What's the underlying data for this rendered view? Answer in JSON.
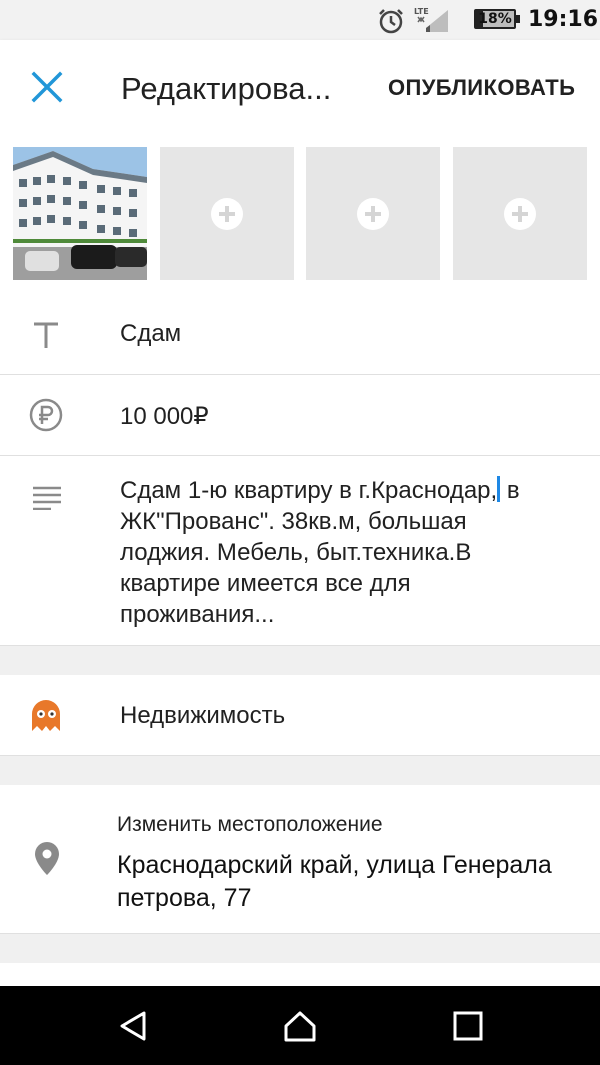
{
  "status_bar": {
    "network": "LTE",
    "battery": "18%",
    "time": "19:16"
  },
  "app_bar": {
    "title": "Редактирова...",
    "publish_label": "ОПУБЛИКОВАТЬ",
    "accent_color": "#2196d8"
  },
  "photos": {
    "slots": [
      {
        "state": "filled"
      },
      {
        "state": "empty"
      },
      {
        "state": "empty"
      },
      {
        "state": "empty"
      }
    ]
  },
  "form": {
    "title": "Сдам",
    "price": "10 000₽",
    "description_before_cursor": "Сдам 1-ю квартиру в г.Краснодар,",
    "description_after_cursor": " в\nЖК\"Прованс\". 38кв.м, большая\nлоджия. Мебель, быт.техника.В\nквартире имеется все для\nпроживания...",
    "category": "Недвижимость",
    "category_icon_color": "#e8782a",
    "location_label": "Изменить местоположение",
    "location_value": "Краснодарский край, улица Генерала петрова, 77"
  }
}
